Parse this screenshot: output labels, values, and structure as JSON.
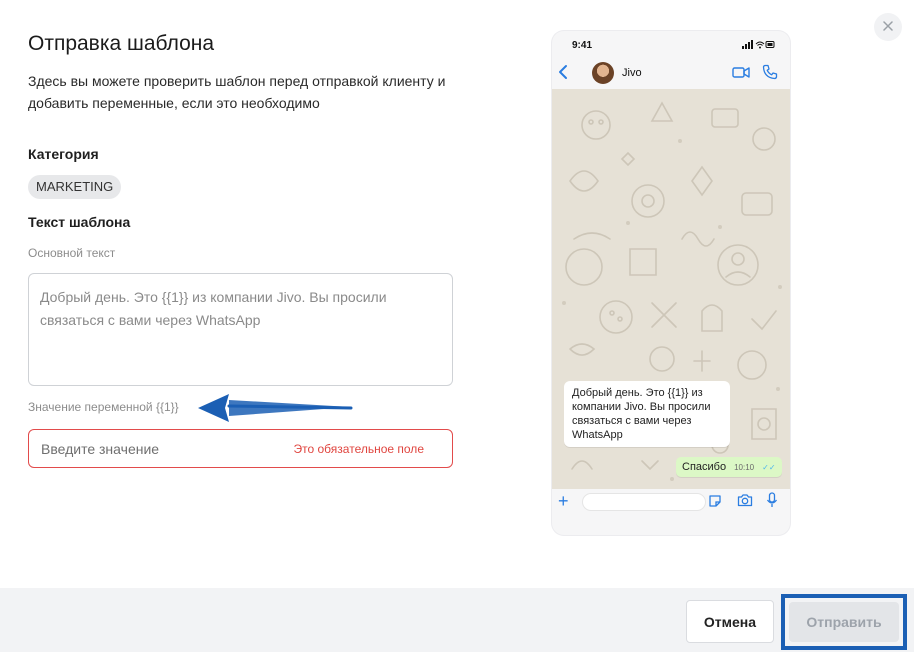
{
  "modal": {
    "title": "Отправка шаблона",
    "description": "Здесь вы можете проверить шаблон перед отправкой клиенту и добавить переменные, если это необходимо",
    "close_icon": "close-icon"
  },
  "category": {
    "label": "Категория",
    "value": "MARKETING"
  },
  "template": {
    "label": "Текст шаблона",
    "body_label": "Основной текст",
    "body_text": "Добрый день. Это {{1}} из компании Jivo. Вы просили связаться с вами через WhatsApp"
  },
  "variable": {
    "label": "Значение переменной {{1}}",
    "placeholder": "Введите значение",
    "error": "Это обязательное поле",
    "arrow_color": "#1b5fb4"
  },
  "preview": {
    "status_time": "9:41",
    "contact_name": "Jivo",
    "incoming_message": "Добрый день. Это {{1}} из компании Jivo. Вы просили связаться с вами через WhatsApp",
    "outgoing_message": "Спасибо",
    "outgoing_time": "10:10",
    "outgoing_tick": "✓✓"
  },
  "footer": {
    "cancel_label": "Отмена",
    "send_label": "Отправить"
  },
  "colors": {
    "error": "#e24b4b",
    "highlight": "#1b5fb4",
    "chat_bg": "#e6e1d6",
    "outgoing_bubble": "#dcf8c6",
    "ios_blue": "#2a7de1"
  }
}
